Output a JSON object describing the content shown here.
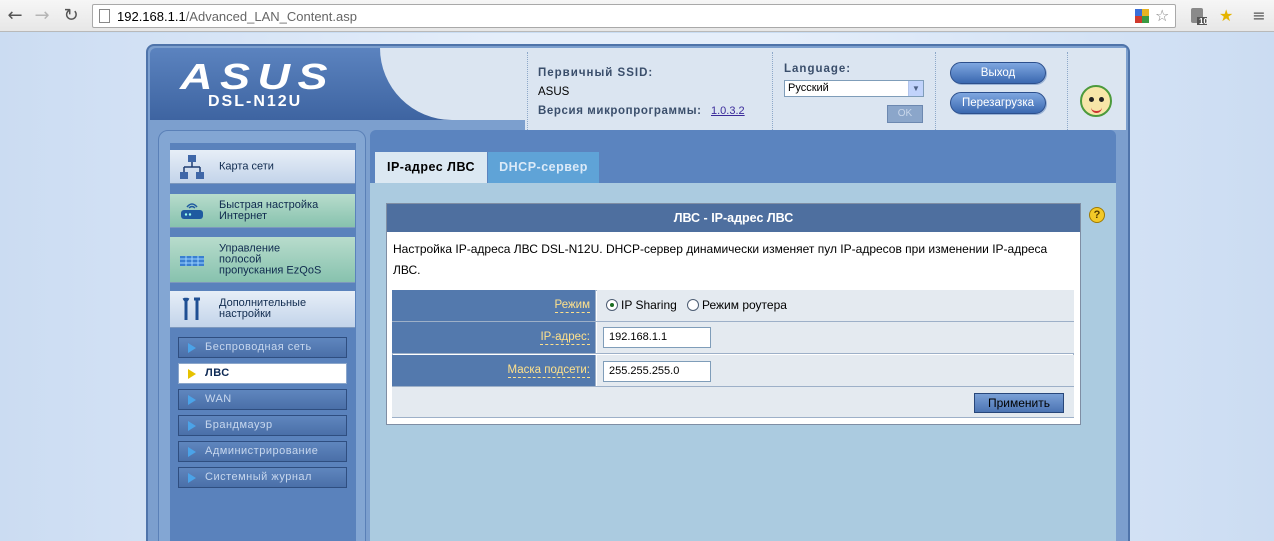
{
  "browser": {
    "url_host": "192.168.1.1",
    "url_path": "/Advanced_LAN_Content.asp",
    "extension_badge": "10"
  },
  "header": {
    "logo_text": "ASUS",
    "model": "DSL-N12U",
    "ssid_label": "Первичный SSID:",
    "ssid_value": "ASUS",
    "firmware_label": "Версия микропрограммы:",
    "firmware_value": "1.0.3.2",
    "language_label": "Language:",
    "language_selected": "Русский",
    "ok_label": "OK",
    "logout_label": "Выход",
    "reboot_label": "Перезагрузка"
  },
  "sidebar": {
    "main_items": [
      {
        "label": "Карта сети"
      },
      {
        "label": "Быстрая настройка\nИнтернет"
      },
      {
        "label": "Управление\nполосой\nпропускания EzQoS"
      },
      {
        "label": "Дополнительные\nнастройки"
      }
    ],
    "sub_items": [
      {
        "label": "Беспроводная сеть"
      },
      {
        "label": "ЛВС"
      },
      {
        "label": "WAN"
      },
      {
        "label": "Брандмауэр"
      },
      {
        "label": "Администрирование"
      },
      {
        "label": "Системный журнал"
      }
    ]
  },
  "tabs": [
    {
      "label": "IP-адрес ЛВС"
    },
    {
      "label": "DHCP-сервер"
    }
  ],
  "panel": {
    "title": "ЛВС - IP-адрес ЛВС",
    "description": "Настройка IP-адреса ЛВС DSL-N12U. DHCP-сервер динамически изменяет пул IP-адресов при изменении IP-адреса ЛВС.",
    "mode_label": "Режим",
    "mode_options": [
      "IP Sharing",
      "Режим роутера"
    ],
    "mode_selected": "IP Sharing",
    "ip_label": "IP-адрес:",
    "ip_value": "192.168.1.1",
    "mask_label": "Маска подсети:",
    "mask_value": "255.255.255.0",
    "apply_label": "Применить"
  },
  "colors": {
    "accent": "#4e6f9f",
    "link": "#3a2a9a",
    "label_yellow": "#ffe18b"
  }
}
